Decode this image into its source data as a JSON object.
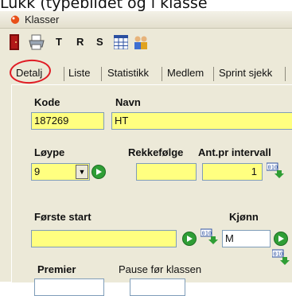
{
  "caption": "Lukk (typebildet og i klasse",
  "window": {
    "title": "Klasser"
  },
  "toolbar": {
    "items": [
      {
        "name": "exit-icon"
      },
      {
        "name": "printer-icon"
      },
      {
        "label": "T"
      },
      {
        "label": "R"
      },
      {
        "label": "S"
      },
      {
        "name": "grid-icon"
      },
      {
        "name": "people-icon"
      }
    ]
  },
  "tabs": [
    {
      "label": "Detalj",
      "active": true
    },
    {
      "label": "Liste"
    },
    {
      "label": "Statistikk"
    },
    {
      "label": "Medlem"
    },
    {
      "label": "Sprint sjekk"
    }
  ],
  "form": {
    "kode": {
      "label": "Kode",
      "value": "187269"
    },
    "navn": {
      "label": "Navn",
      "value": "HT"
    },
    "loype": {
      "label": "Løype",
      "value": "9"
    },
    "rekkefolge": {
      "label": "Rekkefølge",
      "value": ""
    },
    "ant_pr_intervall": {
      "label": "Ant.pr intervall",
      "value": "1"
    },
    "forste_start": {
      "label": "Første start",
      "value": ""
    },
    "kjonn": {
      "label": "Kjønn",
      "value": "M"
    },
    "premier": {
      "label": "Premier",
      "value": ""
    },
    "pause": {
      "label": "Pause før klassen",
      "value": ""
    }
  },
  "colors": {
    "field_bg": "#ffff80",
    "highlight_ring": "#e01b24",
    "go_button": "#2f9e35"
  }
}
